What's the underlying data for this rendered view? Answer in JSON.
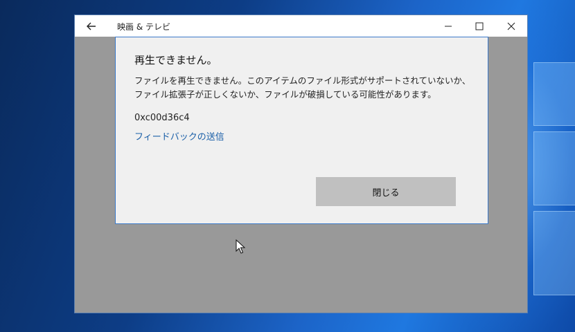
{
  "window": {
    "title": "映画 & テレビ"
  },
  "dialog": {
    "title": "再生できません。",
    "message": "ファイルを再生できません。このアイテムのファイル形式がサポートされていないか、ファイル拡張子が正しくないか、ファイルが破損している可能性があります。",
    "error_code": "0xc00d36c4",
    "feedback_link": "フィードバックの送信",
    "close_button": "閉じる"
  },
  "icons": {
    "back": "back-arrow-icon",
    "minimize": "minimize-icon",
    "maximize": "maximize-icon",
    "close": "close-icon",
    "cursor": "mouse-pointer-icon"
  },
  "colors": {
    "dialog_border": "#3a78c8",
    "link": "#1a5fa8",
    "window_backdrop": "#999999"
  }
}
